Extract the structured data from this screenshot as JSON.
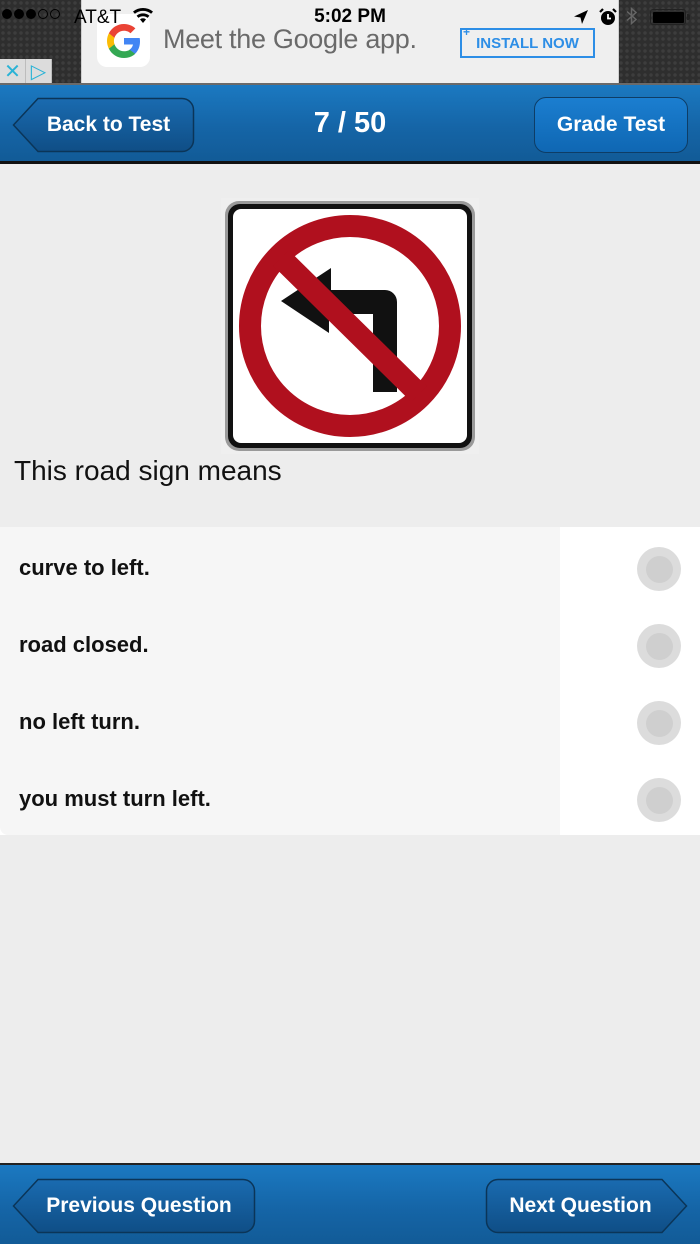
{
  "status_bar": {
    "signal_bars_on": 3,
    "signal_bars_total": 5,
    "carrier": "AT&T",
    "time": "5:02 PM",
    "icons": [
      "wifi-icon",
      "location-arrow-icon",
      "alarm-icon",
      "bluetooth-icon",
      "battery-icon"
    ]
  },
  "ad": {
    "logo": "G",
    "text": "Meet the Google app.",
    "cta": "INSTALL NOW",
    "cta_plus": "+",
    "close_glyph": "✕",
    "adchoices_glyph": "▷",
    "colors": {
      "cta": "#2d8ee6",
      "adchoices": "#2ab3d6"
    }
  },
  "header": {
    "back_label": "Back to Test",
    "progress": "7 / 50",
    "grade_label": "Grade Test"
  },
  "question": {
    "image_alt": "No left turn road sign",
    "text": "This road sign means",
    "sign_colors": {
      "ring": "#b0101e",
      "arrow": "#111111",
      "border": "#111111",
      "background": "#ffffff"
    }
  },
  "answers": [
    {
      "label": "curve to left.",
      "selected": false
    },
    {
      "label": "road closed.",
      "selected": false
    },
    {
      "label": "no left turn.",
      "selected": false
    },
    {
      "label": "you must turn left.",
      "selected": false
    }
  ],
  "footer": {
    "previous_label": "Previous Question",
    "next_label": "Next Question"
  },
  "theme": {
    "nav_blue": "#1565a7",
    "page_background": "#ededed"
  }
}
